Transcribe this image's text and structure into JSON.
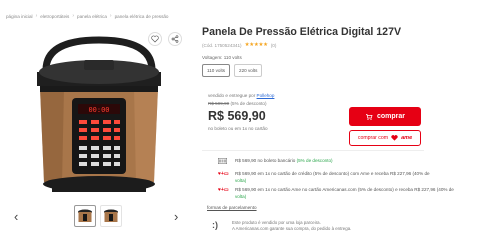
{
  "breadcrumb": [
    "página inicial",
    "eletroportáteis",
    "panela elétrica",
    "panela elétrica de pressão"
  ],
  "product": {
    "title": "Panela De Pressão Elétrica Digital 127V",
    "code": "(Cód. 1750524341)",
    "stars": "★★★★★",
    "review_count": "(0)",
    "voltage_label": "Voltagem: 110 volts",
    "voltage_options": [
      "110 volts",
      "220 volts"
    ]
  },
  "buy_box": {
    "seller_prefix": "vendido e entregue por",
    "seller_name": "Pollehop",
    "old_price": "R$ 599,90",
    "discount": "(5% de desconto)",
    "price": "R$ 569,90",
    "installment": "no boleto ou em 1x no cartão",
    "buy_label": "comprar",
    "ame_label": "comprar com",
    "ame_brand": "ame"
  },
  "payments": [
    {
      "icon": "boleto-icon",
      "text": "R$ 569,90 no boleto bancário",
      "highlight": "(5% de desconto)"
    },
    {
      "icon": "ame-card-icon",
      "text": "R$ 569,90 em 1x no cartão de crédito (5% de desconto) com Ame e receba R$ 227,96 (40% de",
      "text2": "volta)"
    },
    {
      "icon": "ame-americanas-card-icon",
      "text": "R$ 569,90 em 1x no cartão Ame no cartão Americanas.com (5% de desconto) e receba R$ 227,96 (40% de",
      "text2": "volta)"
    }
  ],
  "forms_link": "formas de parcelamento",
  "partner": {
    "line1": "Este produto é vendido por uma loja parceira.",
    "line2": "A Americanas.com garante sua compra, do pedido à entrega."
  },
  "colors": {
    "accent": "#e60014",
    "green": "#2aa54b",
    "link": "#2c6ad6"
  }
}
